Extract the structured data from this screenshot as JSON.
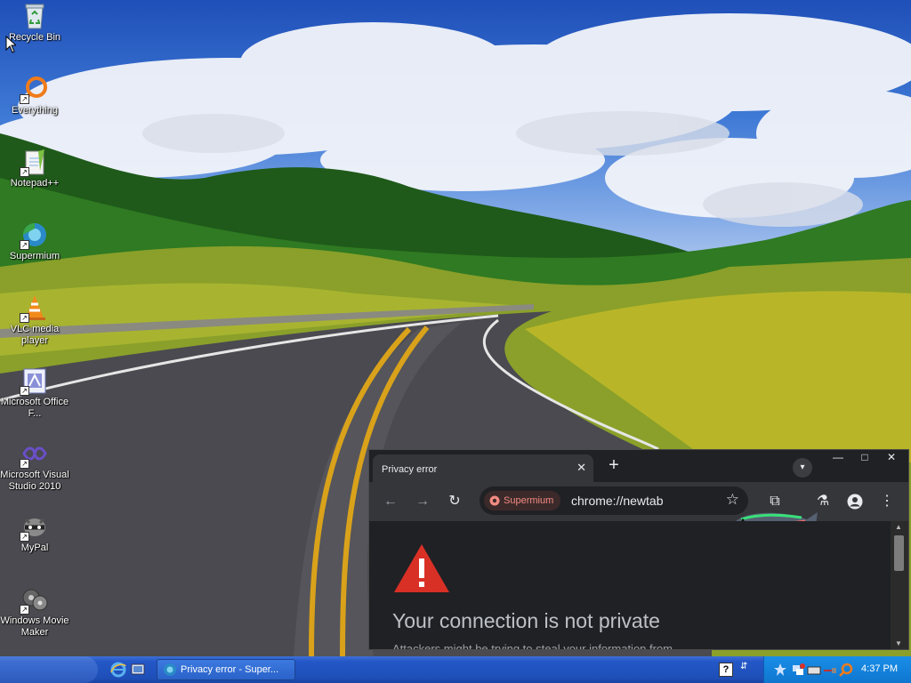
{
  "desktop": {
    "icons": [
      {
        "label": "Recycle Bin",
        "icon": "recycle-bin-icon",
        "shortcut": false
      },
      {
        "label": "Everything",
        "icon": "everything-search-icon",
        "shortcut": true
      },
      {
        "label": "Notepad++",
        "icon": "notepad-plus-plus-icon",
        "shortcut": true
      },
      {
        "label": "Supermium",
        "icon": "supermium-browser-icon",
        "shortcut": true
      },
      {
        "label": "VLC media player",
        "icon": "vlc-cone-icon",
        "shortcut": true
      },
      {
        "label": "Microsoft Office F...",
        "icon": "office-file-icon",
        "shortcut": true
      },
      {
        "label": "Microsoft Visual Studio 2010",
        "icon": "visual-studio-icon",
        "shortcut": true
      },
      {
        "label": "MyPal",
        "icon": "mypal-raccoon-icon",
        "shortcut": true
      },
      {
        "label": "Windows Movie Maker",
        "icon": "movie-maker-icon",
        "shortcut": true
      }
    ]
  },
  "browser": {
    "tab_title": "Privacy error",
    "tab_close": "✕",
    "new_tab": "+",
    "window_controls": {
      "minimize": "—",
      "maximize": "□",
      "close": "✕"
    },
    "security_chip": "Supermium",
    "url": "chrome://newtab",
    "page": {
      "heading": "Your connection is not private",
      "partial_text": "Attackers might be trying to steal your information from"
    }
  },
  "taskbar": {
    "window_button": "Privacy error - Super...",
    "clock": "4:37 PM",
    "help": "?"
  },
  "colors": {
    "browser_bg": "#202124",
    "toolbar_bg": "#35363a",
    "warning_red": "#d93025",
    "taskbar_blue": "#2457c7"
  }
}
